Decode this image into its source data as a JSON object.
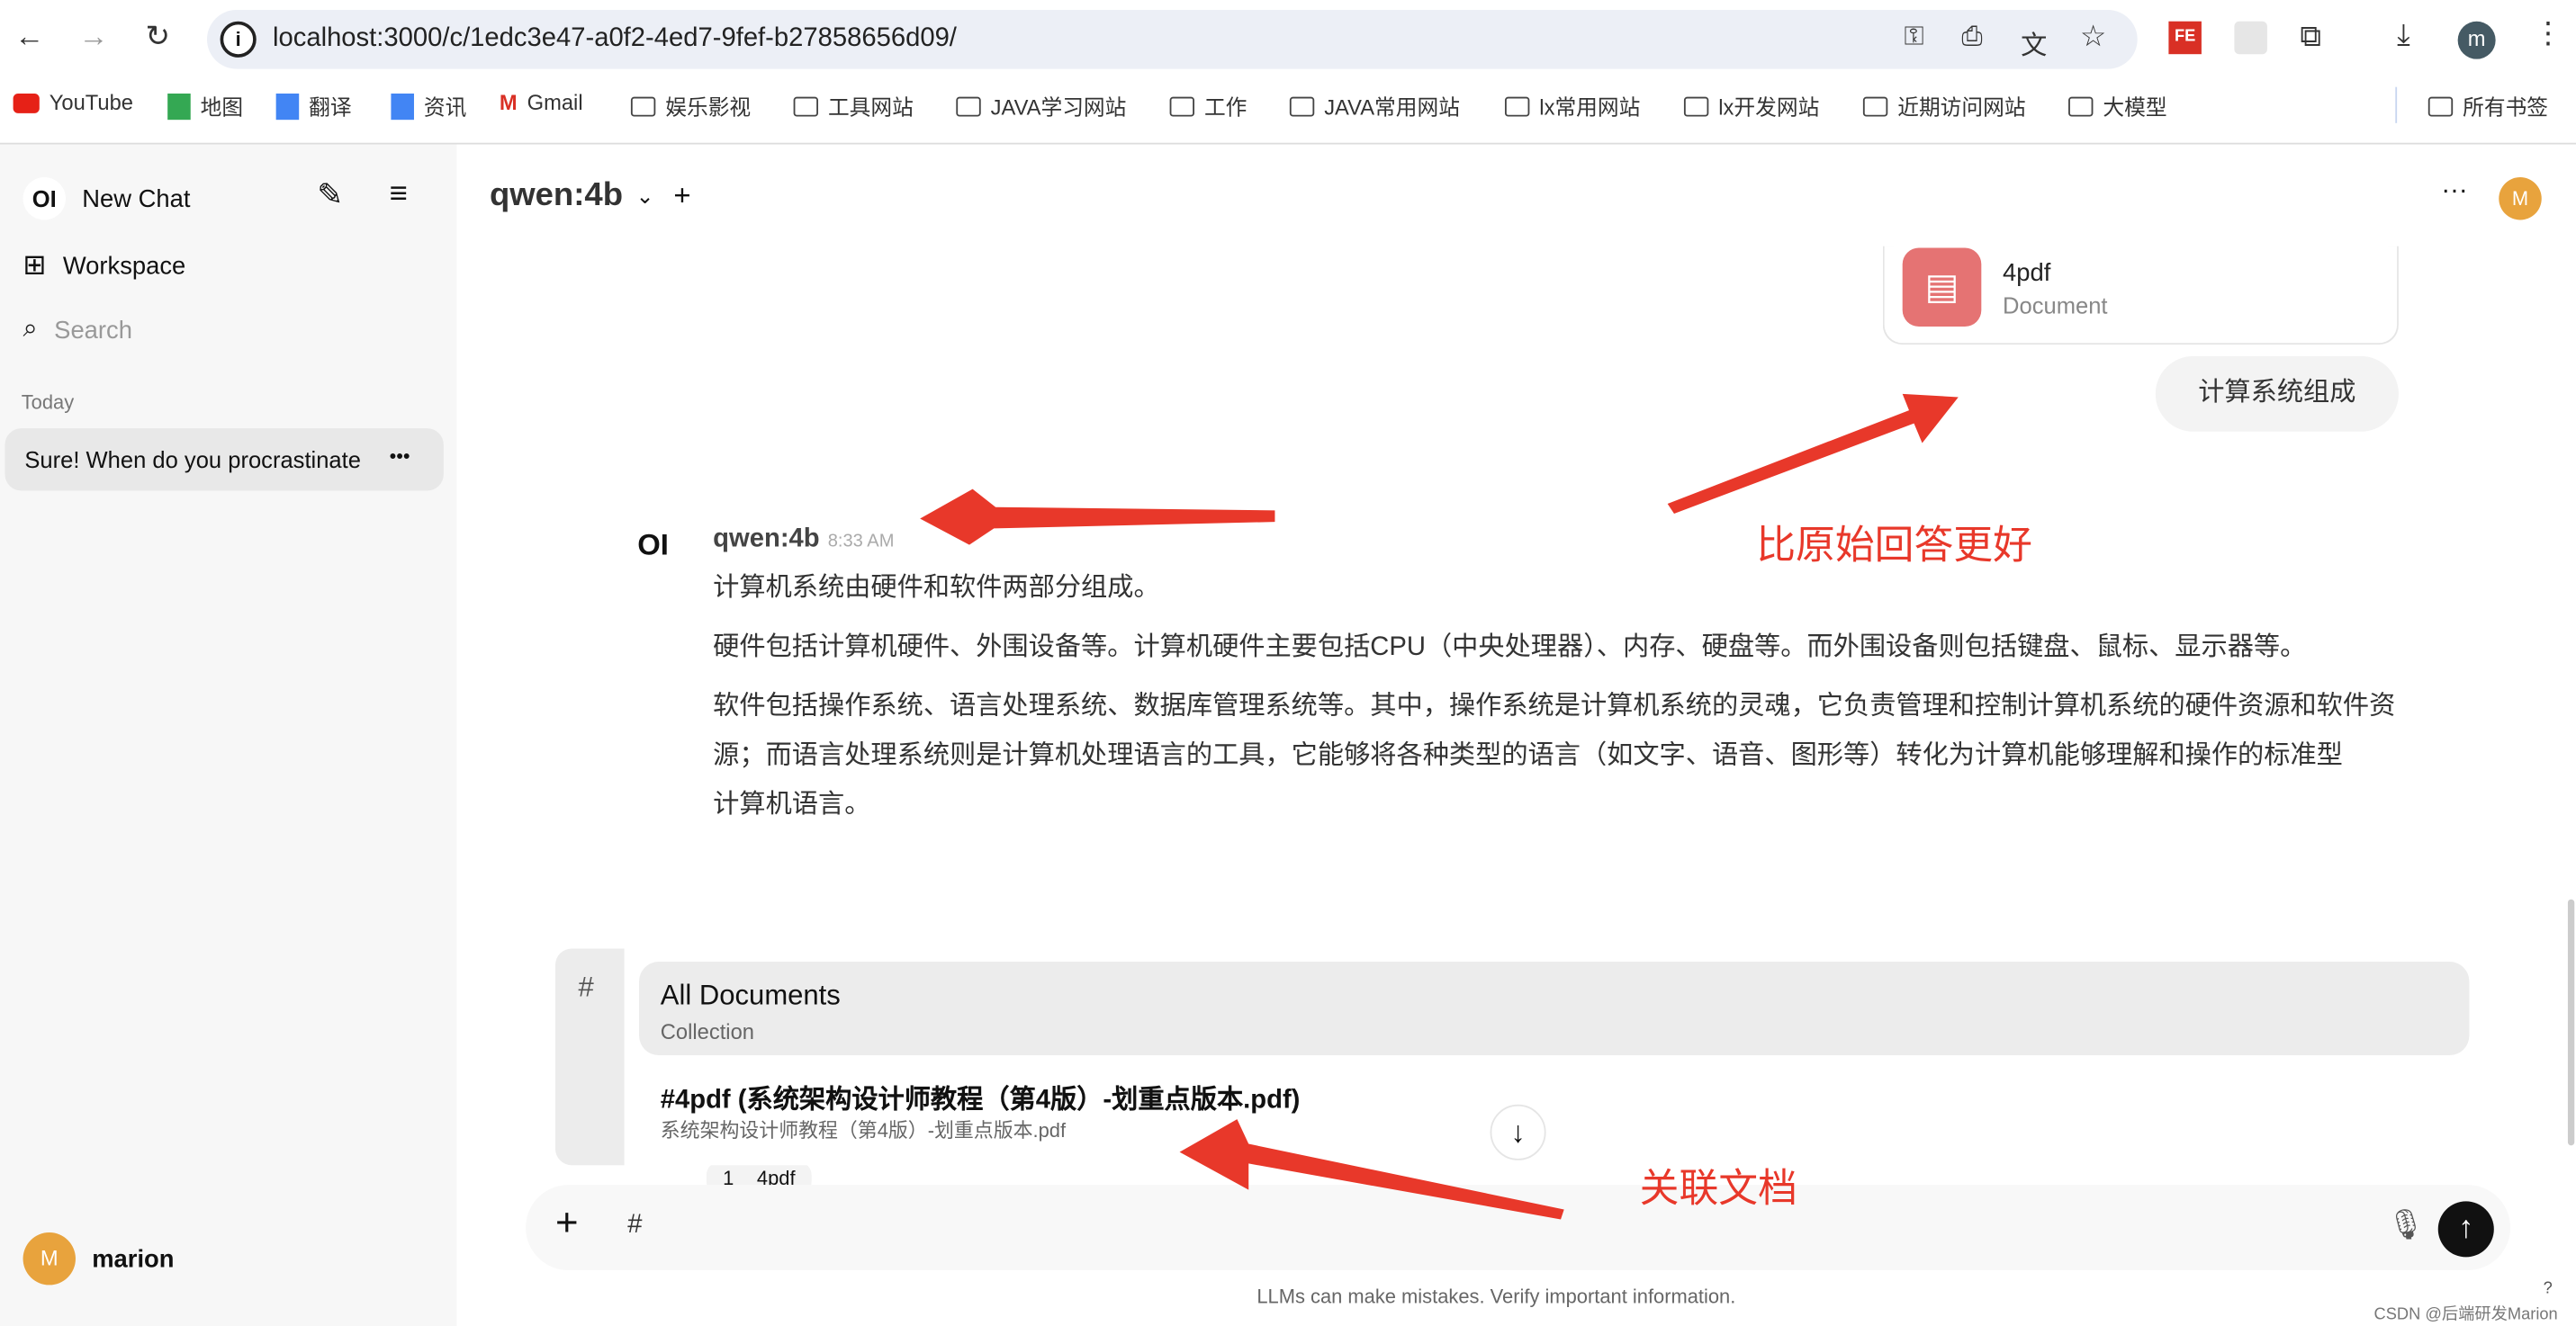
{
  "browser": {
    "url": "localhost:3000/c/1edc3e47-a0f2-4ed7-9fef-b27858656d09/",
    "profile_initial": "m",
    "ext_label": "FE",
    "bookmarks": [
      "YouTube",
      "地图",
      "翻译",
      "资讯",
      "Gmail",
      "娱乐影视",
      "工具网站",
      "JAVA学习网站",
      "工作",
      "JAVA常用网站",
      "lx常用网站",
      "lx开发网站",
      "近期访问网站",
      "大模型"
    ],
    "all_bookmarks": "所有书签"
  },
  "sidebar": {
    "logo": "OI",
    "new_chat": "New Chat",
    "workspace": "Workspace",
    "search_placeholder": "Search",
    "section": "Today",
    "chat_item": "Sure! When do you procrastinate",
    "more": "•••",
    "user_initial": "M",
    "user_name": "marion"
  },
  "header": {
    "model": "qwen:4b",
    "more": "···",
    "avatar": "M"
  },
  "chat": {
    "attachment": {
      "name": "4pdf",
      "type": "Document"
    },
    "user_message": "计算系统组成",
    "assistant": {
      "logo": "OI",
      "name": "qwen:4b",
      "time": "8:33 AM",
      "paragraphs": [
        "计算机系统由硬件和软件两部分组成。",
        "硬件包括计算机硬件、外围设备等。计算机硬件主要包括CPU（中央处理器）、内存、硬盘等。而外围设备则包括键盘、鼠标、显示器等。",
        "软件包括操作系统、语言处理系统、数据库管理系统等。其中，操作系统是计算机系统的灵魂，它负责管理和控制计算机系统的硬件资源和软件资源；而语言处理系统则是计算机处理语言的工具，它能够将各种类型的语言（如文字、语音、图形等）转化为计算机能够理解和操作的标准型",
        "计算机语言。"
      ]
    },
    "citation": {
      "index": "1",
      "name": "4pdf"
    }
  },
  "doc_popup": {
    "hash": "#",
    "items": [
      {
        "title": "All Documents",
        "subtitle": "Collection"
      },
      {
        "title": "#4pdf (系统架构设计师教程（第4版）-划重点版本.pdf)",
        "subtitle": "系统架构设计师教程（第4版）-划重点版本.pdf"
      }
    ]
  },
  "input": {
    "value": "#",
    "plus": "+"
  },
  "footer": "LLMs can make mistakes. Verify important information.",
  "annotations": [
    "比原始回答更好",
    "关联文档"
  ],
  "watermark": "CSDN @后端研发Marion",
  "help": "?",
  "colors": {
    "annotation": "#e8382a",
    "accent": "#e8a33d"
  }
}
